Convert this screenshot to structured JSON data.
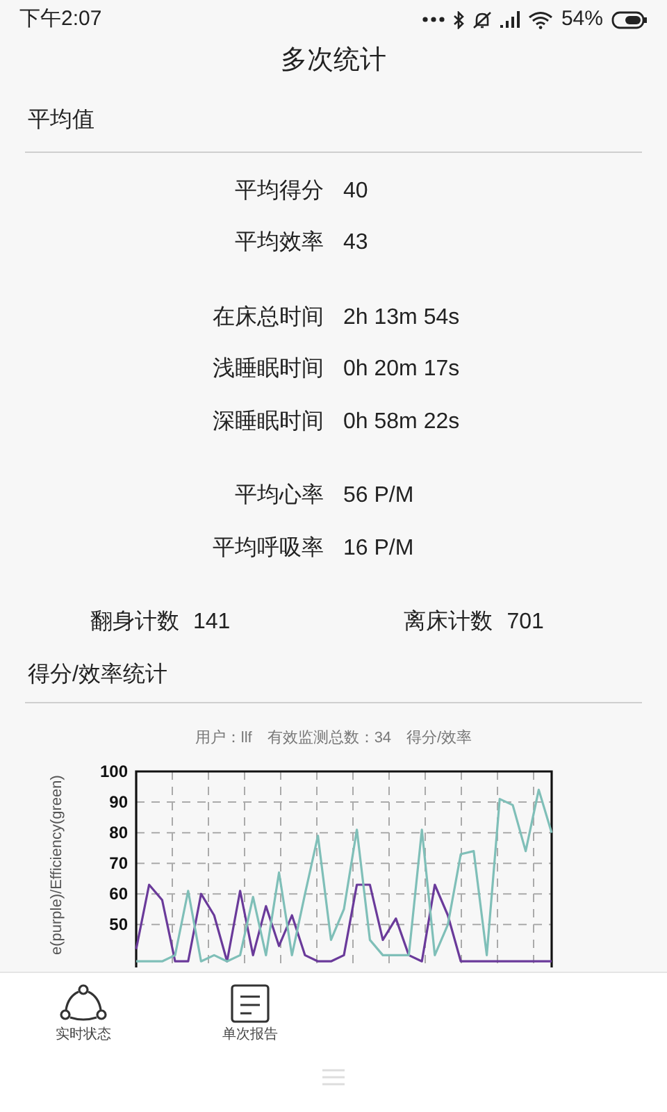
{
  "status_bar": {
    "time": "下午2:07",
    "battery": "54%"
  },
  "title": "多次统计",
  "average_section": {
    "title": "平均值",
    "groups": [
      [
        {
          "label": "平均得分",
          "value": "40"
        },
        {
          "label": "平均效率",
          "value": "43"
        }
      ],
      [
        {
          "label": "在床总时间",
          "value": "2h 13m 54s"
        },
        {
          "label": "浅睡眠时间",
          "value": "0h 20m 17s"
        },
        {
          "label": "深睡眠时间",
          "value": "0h 58m 22s"
        }
      ],
      [
        {
          "label": "平均心率",
          "value": "56 P/M"
        },
        {
          "label": "平均呼吸率",
          "value": "16 P/M"
        }
      ]
    ],
    "counts": [
      {
        "label": "翻身计数",
        "value": "141"
      },
      {
        "label": "离床计数",
        "value": "701"
      }
    ]
  },
  "chart_section": {
    "title": "得分/效率统计",
    "subtitle": "用户：llf　有效监测总数：34　得分/效率",
    "chart_data": {
      "type": "line",
      "ylabel": "e(purple)/Efficiency(green)",
      "ylim": [
        36,
        100
      ],
      "yticks": [
        50,
        60,
        70,
        80,
        90,
        100
      ],
      "grid": true,
      "series": [
        {
          "color": "#6a3a9a",
          "values": [
            42,
            63,
            58,
            38,
            38,
            60,
            53,
            38,
            61,
            40,
            56,
            43,
            53,
            40,
            38,
            38,
            40,
            63,
            63,
            45,
            52,
            40,
            38,
            63,
            53,
            38,
            38,
            38,
            38,
            38,
            38,
            38,
            38
          ]
        },
        {
          "color": "#7fbfb8",
          "values": [
            38,
            38,
            38,
            40,
            61,
            38,
            40,
            38,
            40,
            59,
            40,
            67,
            40,
            60,
            79,
            45,
            55,
            81,
            45,
            40,
            40,
            40,
            81,
            40,
            50,
            73,
            74,
            40,
            91,
            89,
            74,
            94,
            80
          ]
        }
      ]
    }
  },
  "bottom_nav": [
    {
      "label": "实时状态",
      "kind": "share"
    },
    {
      "label": "单次报告",
      "kind": "report"
    }
  ]
}
